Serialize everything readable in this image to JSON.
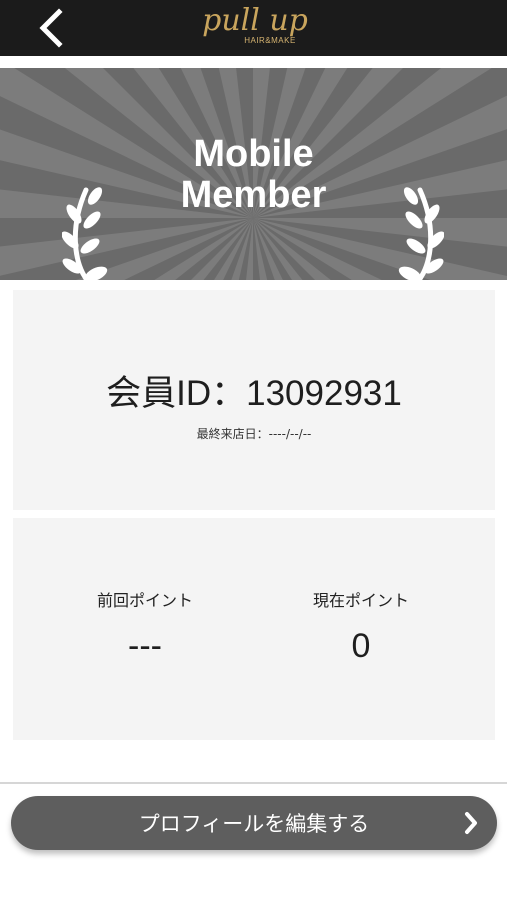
{
  "header": {
    "back_icon": "chevron-left-icon",
    "logo_main": "pull up",
    "logo_sub": "HAIR&MAKE",
    "background_color": "#1b1b1b",
    "logo_color": "#c9a55d"
  },
  "banner": {
    "title_line1": "Mobile",
    "title_line2": "Member",
    "left_icon": "laurel-branch-icon",
    "right_icon": "laurel-branch-icon"
  },
  "member": {
    "id_text": "会員ID：13092931",
    "last_visit": "最終来店日：----/--/--"
  },
  "points": {
    "previous_label": "前回ポイント",
    "previous_value": "---",
    "current_label": "現在ポイント",
    "current_value": "0"
  },
  "actions": {
    "edit_profile_label": "プロフィールを編集する",
    "edit_profile_icon": "chevron-right-icon",
    "button_color": "#5e5e5e"
  }
}
